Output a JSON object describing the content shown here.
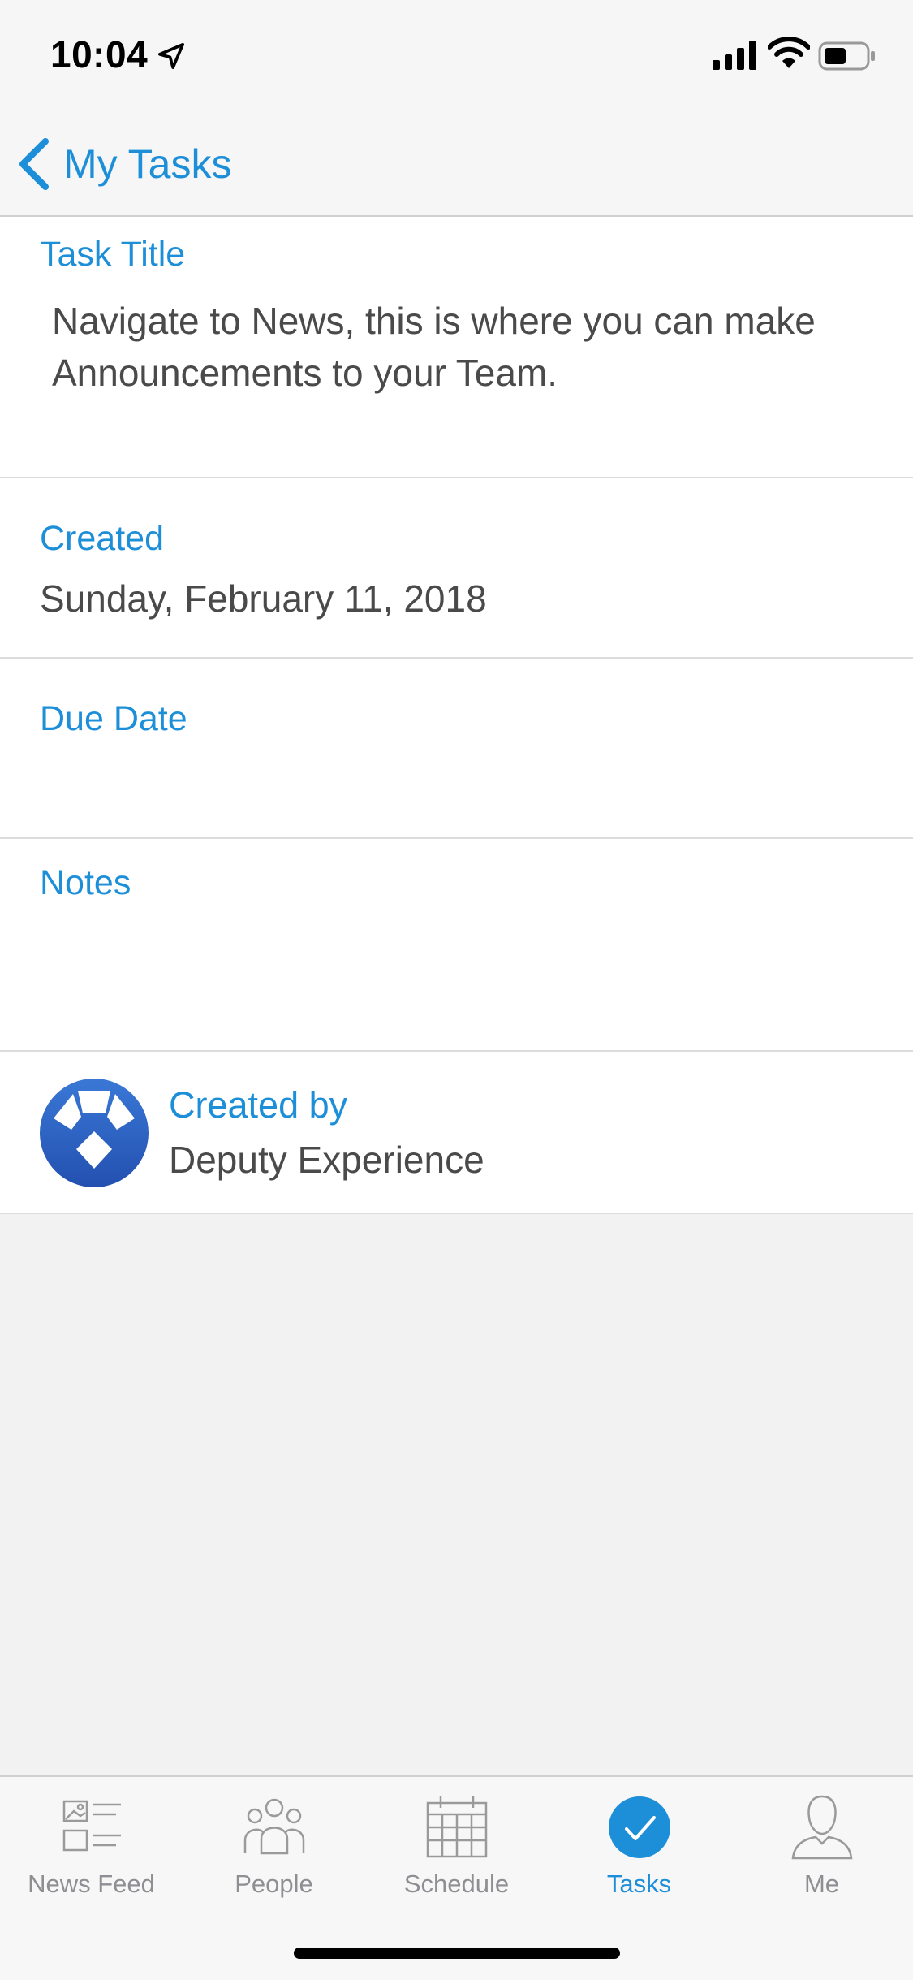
{
  "status": {
    "time": "10:04"
  },
  "nav": {
    "back_label": "My Tasks"
  },
  "task": {
    "title_label": "Task Title",
    "title_value": "Navigate to News, this is where you can make Announcements to your Team.",
    "created_label": "Created",
    "created_value": "Sunday, February 11, 2018",
    "due_label": "Due Date",
    "due_value": "",
    "notes_label": "Notes",
    "notes_value": "",
    "created_by_label": "Created by",
    "created_by_value": "Deputy Experience"
  },
  "tabs": [
    {
      "label": "News Feed",
      "icon": "news-feed-icon",
      "active": false
    },
    {
      "label": "People",
      "icon": "people-icon",
      "active": false
    },
    {
      "label": "Schedule",
      "icon": "calendar-icon",
      "active": false
    },
    {
      "label": "Tasks",
      "icon": "check-circle-icon",
      "active": true
    },
    {
      "label": "Me",
      "icon": "person-icon",
      "active": false
    }
  ],
  "colors": {
    "accent": "#1d8ed8",
    "text": "#4a4a4a",
    "background": "#f2f2f2",
    "avatar": "#2a5fc1"
  }
}
